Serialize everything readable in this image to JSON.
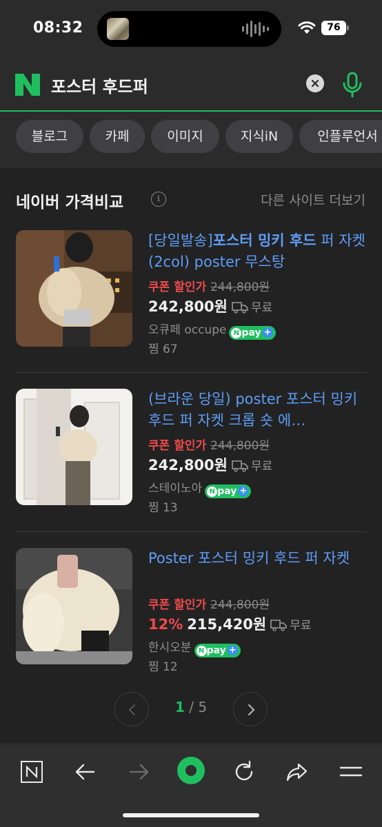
{
  "status_bar": {
    "time": "08:32",
    "battery": "76"
  },
  "search": {
    "query": "포스터 후드퍼"
  },
  "chips": [
    "블로그",
    "카페",
    "이미지",
    "지식iN",
    "인플루언서"
  ],
  "section": {
    "title": "네이버 가격비교",
    "more": "다른 사이트 더보기"
  },
  "products": [
    {
      "title_prefix": "[당일발송]",
      "title_bold": "포스터 밍키 후드",
      "title_rest": " 퍼 자켓 (2col) poster 무스탕",
      "coupon_label": "쿠폰 할인가",
      "original_price": "244,800원",
      "discount": "",
      "price": "242,800원",
      "shipping": "무료",
      "seller": "오큐페 occupe",
      "npay": "pay",
      "zzim": "찜 67"
    },
    {
      "title_prefix": "",
      "title_bold": "",
      "title_rest": "(브라운 당일) poster 포스터 밍키 후드 퍼 자켓 크롭 숏 에…",
      "coupon_label": "쿠폰 할인가",
      "original_price": "244,800원",
      "discount": "",
      "price": "242,800원",
      "shipping": "무료",
      "seller": "스테이노아",
      "npay": "pay",
      "zzim": "찜 13"
    },
    {
      "title_prefix": "",
      "title_bold": "",
      "title_rest": "Poster 포스터 밍키 후드 퍼 자켓",
      "coupon_label": "쿠폰 할인가",
      "original_price": "244,800원",
      "discount": "12%",
      "price": "215,420원",
      "shipping": "무료",
      "seller": "한시오분",
      "npay": "pay",
      "zzim": "찜 12"
    }
  ],
  "pagination": {
    "current": "1",
    "total": "/ 5"
  },
  "colors": {
    "accent_green": "#1fbf5f",
    "link_blue": "#5f9df6",
    "sale_red": "#ef4a4a"
  },
  "toolbar_icons": [
    "naver-home-icon",
    "back-arrow-icon",
    "forward-arrow-icon",
    "green-dot-icon",
    "refresh-icon",
    "share-icon",
    "menu-icon"
  ]
}
